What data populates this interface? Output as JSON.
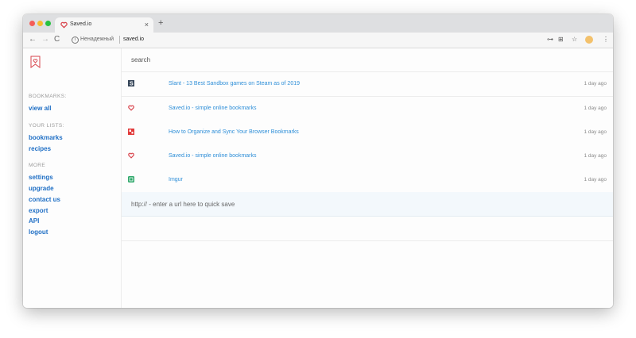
{
  "browser": {
    "tab_title": "Saved.io",
    "tab_close": "×",
    "new_tab": "+",
    "url_security": "Ненадежный",
    "url": "saved.io",
    "nav_back": "←",
    "nav_forward": "→",
    "nav_reload": "C",
    "info": "i",
    "key": "⊶",
    "translate": "⊞",
    "star": "☆",
    "menu": "⋮"
  },
  "sidebar": {
    "bookmarks_label": "BOOKMARKS:",
    "view_all": "view all",
    "lists_label": "YOUR LISTS:",
    "lists": [
      "bookmarks",
      "recipes"
    ],
    "more_label": "MORE",
    "more": [
      "settings",
      "upgrade",
      "contact us",
      "export",
      "API",
      "logout"
    ]
  },
  "main": {
    "search_placeholder": "search",
    "quick_save_placeholder": "http:// - enter a url here to quick save",
    "bookmarks": [
      {
        "icon": "slant-favicon",
        "title": "Slant - 13 Best Sandbox games on Steam as of 2019",
        "time": "1 day ago"
      },
      {
        "icon": "savedio-favicon",
        "title": "Saved.io - simple online bookmarks",
        "time": "1 day ago"
      },
      {
        "icon": "article-favicon",
        "title": "How to Organize and Sync Your Browser Bookmarks",
        "time": "1 day ago"
      },
      {
        "icon": "savedio-favicon",
        "title": "Saved.io - simple online bookmarks",
        "time": "1 day ago"
      },
      {
        "icon": "imgur-favicon",
        "title": "Imgur",
        "time": "1 day ago"
      }
    ]
  },
  "colors": {
    "accent": "#1f6fc5",
    "link": "#2f8fd8",
    "brand_red": "#d8434b"
  }
}
